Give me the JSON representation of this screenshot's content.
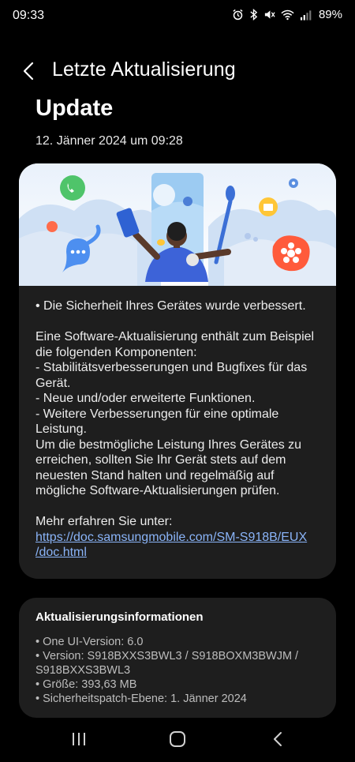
{
  "status_bar": {
    "time": "09:33",
    "battery": "89%",
    "icons": [
      "alarm-icon",
      "bluetooth-icon",
      "mute-icon",
      "wifi-icon",
      "signal-icon"
    ]
  },
  "header": {
    "back_icon": "chevron-left-icon",
    "title": "Letzte Aktualisierung"
  },
  "page": {
    "title": "Update",
    "date": "12. Jänner 2024 um 09:28"
  },
  "notes": {
    "security_line": "• Die Sicherheit Ihres Gerätes wurde verbessert.",
    "intro": "Eine Software-Aktualisierung enthält zum Beispiel die folgenden Komponenten:",
    "item1": " - Stabilitätsverbesserungen und Bugfixes für das Gerät.",
    "item2": " - Neue und/oder erweiterte Funktionen.",
    "item3": " - Weitere Verbesserungen für eine optimale Leistung.",
    "advice": "Um die bestmögliche Leistung Ihres Gerätes zu erreichen, sollten Sie Ihr Gerät stets auf dem neuesten Stand halten und regelmäßig auf mögliche Software-Aktualisierungen prüfen.",
    "more_label": "Mehr erfahren Sie unter:",
    "link_line1": "https://doc.samsungmobile.com/SM-S918B/EUX",
    "link_line2": "/doc.html"
  },
  "info": {
    "title": "Aktualisierungsinformationen",
    "one_ui": "• One UI-Version: 6.0",
    "version": "• Version: S918BXXS3BWL3 / S918BOXM3BWJM / S918BXXS3BWL3",
    "size": "• Größe: 393,63 MB",
    "patch": "• Sicherheitspatch-Ebene: 1. Jänner 2024"
  },
  "nav": {
    "recents_icon": "recents-icon",
    "home_icon": "home-icon",
    "back_icon": "back-icon"
  },
  "colors": {
    "background": "#000000",
    "card": "#1e1e1e",
    "link": "#8ab4f8"
  }
}
